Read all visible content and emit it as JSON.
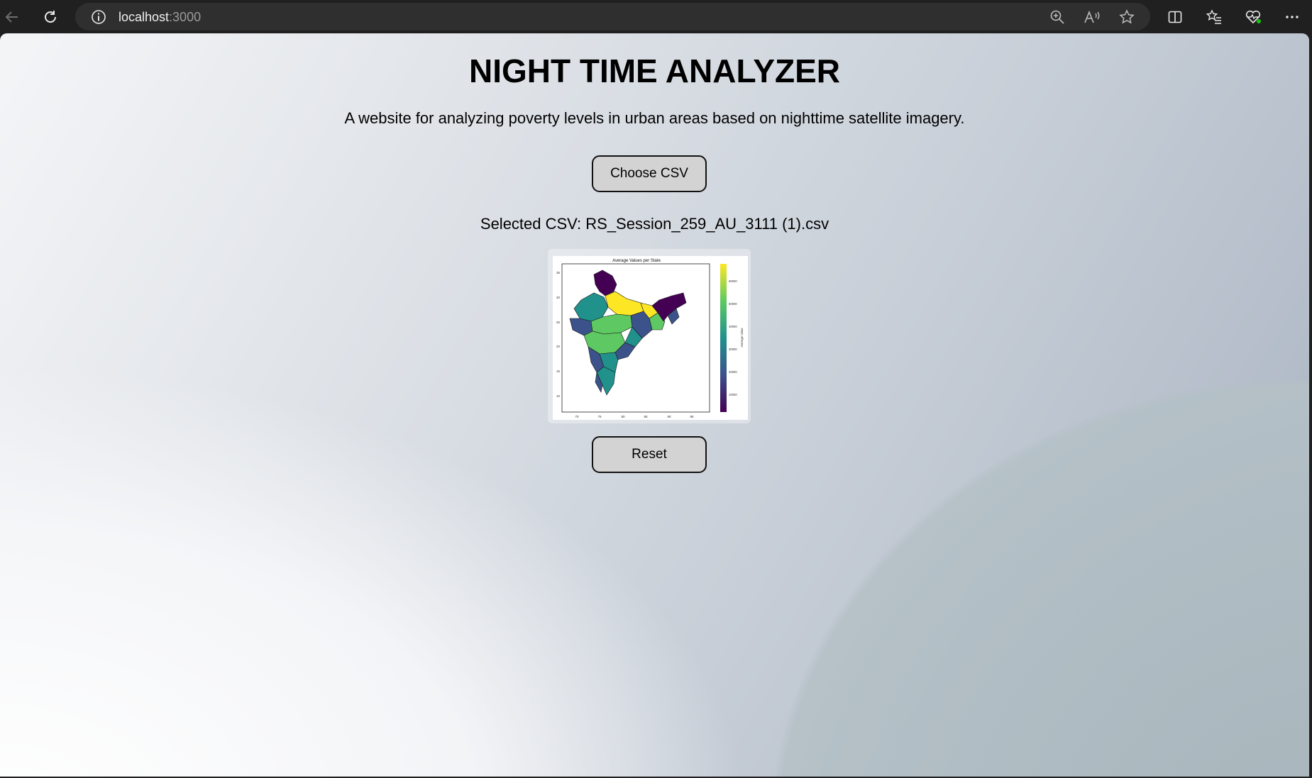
{
  "browser": {
    "url_host": "localhost",
    "url_port": ":3000",
    "icons": {
      "back": "back-arrow-icon",
      "reload": "reload-icon",
      "site_info": "info-icon",
      "zoom": "zoom-in-icon",
      "read_aloud": "read-aloud-icon",
      "favorite": "star-icon",
      "split_screen": "split-screen-icon",
      "favorites": "favorites-list-icon",
      "health": "browser-essentials-icon",
      "menu": "more-menu-icon"
    }
  },
  "page": {
    "title": "NIGHT TIME ANALYZER",
    "description": "A website for analyzing poverty levels in urban areas based on nighttime satellite imagery.",
    "choose_button": "Choose CSV",
    "selected_label": "Selected CSV: RS_Session_259_AU_3111 (1).csv",
    "reset_button": "Reset"
  },
  "map_image": {
    "title": "Average Values per State",
    "colorbar_label": "Average Value",
    "colorbar_ticks": [
      "60000",
      "50000",
      "40000",
      "30000",
      "20000",
      "10000"
    ],
    "y_ticks": [
      "35",
      "30",
      "25",
      "20",
      "15",
      "10"
    ],
    "x_ticks": [
      "70",
      "75",
      "80",
      "85",
      "90",
      "95"
    ],
    "colormap": [
      "#440154",
      "#3b528b",
      "#21918c",
      "#5ec962",
      "#fde725"
    ]
  }
}
